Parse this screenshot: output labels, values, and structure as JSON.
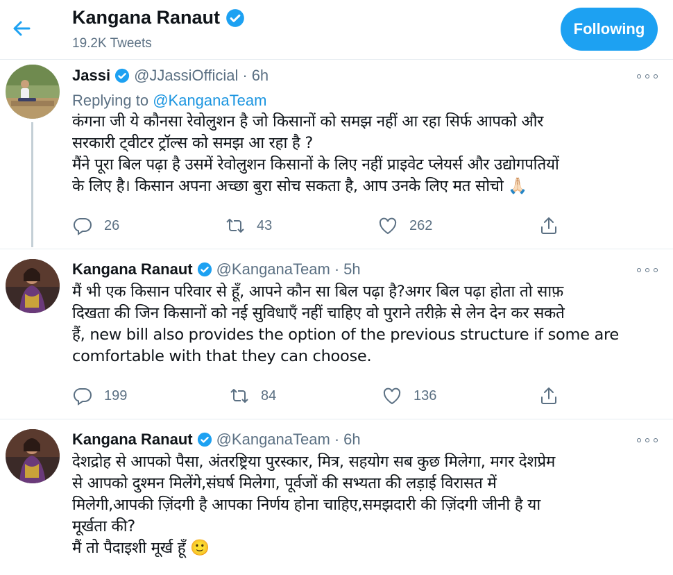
{
  "header": {
    "name": "Kangana Ranaut",
    "tweet_count": "19.2K Tweets",
    "follow_label": "Following"
  },
  "tweets": [
    {
      "name": "Jassi",
      "handle": "@JJassiOfficial",
      "sep": "·",
      "time": "6h",
      "replying_prefix": "Replying to",
      "replying_handle": "@KanganaTeam",
      "lines": [
        "कंगना जी ये कौनसा रेवोलुशन है जो किसानों को समझ नहीं आ रहा सिर्फ आपको और",
        "सरकारी ट्वीटर ट्रॉल्स को समझ आ रहा है ?",
        "मैंने पूरा बिल पढ़ा है उसमें रेवोलुशन किसानों के लिए नहीं प्राइवेट प्लेयर्स और उद्योगपतियों",
        "के लिए है। किसान अपना अच्छा बुरा सोच सकता है, आप उनके लिए मत सोचो 🙏🏻"
      ],
      "replies": "26",
      "retweets": "43",
      "likes": "262"
    },
    {
      "name": "Kangana Ranaut",
      "handle": "@KanganaTeam",
      "sep": "·",
      "time": "5h",
      "lines": [
        "मैं भी एक किसान परिवार से हूँ, आपने कौन सा बिल पढ़ा है?अगर बिल पढ़ा होता तो साफ़",
        "दिखता की जिन किसानों को नई सुविधाएँ नहीं चाहिए वो पुराने तरीक़े से लेन देन कर सकते",
        "हैं, new bill also provides the option of the previous structure if some are",
        "comfortable with that they can choose."
      ],
      "replies": "199",
      "retweets": "84",
      "likes": "136"
    },
    {
      "name": "Kangana Ranaut",
      "handle": "@KanganaTeam",
      "sep": "·",
      "time": "6h",
      "lines": [
        "देशद्रोह से आपको पैसा, अंतरष्ट्रिया पुरस्कार, मित्र, सहयोग सब कुछ मिलेगा, मगर देशप्रेम",
        "से आपको दुश्मन मिलेंगे,संघर्ष मिलेगा, पूर्वजों की सभ्यता की लड़ाई विरासत में",
        "मिलेगी,आपकी ज़िंदगी है आपका निर्णय होना चाहिए,समझदारी की ज़िंदगी जीनी है या",
        "मूर्खता की?",
        "मैं तो पैदाइशी मूर्ख हूँ 🙂"
      ]
    }
  ],
  "colors": {
    "accent": "#1da1f2",
    "link": "#1b95e0",
    "secondary_text": "#5b7083",
    "divider": "#e6ecf0"
  },
  "icons": [
    "back-arrow-icon",
    "verified-badge-icon",
    "more-icon",
    "reply-icon",
    "retweet-icon",
    "like-icon",
    "share-icon"
  ]
}
